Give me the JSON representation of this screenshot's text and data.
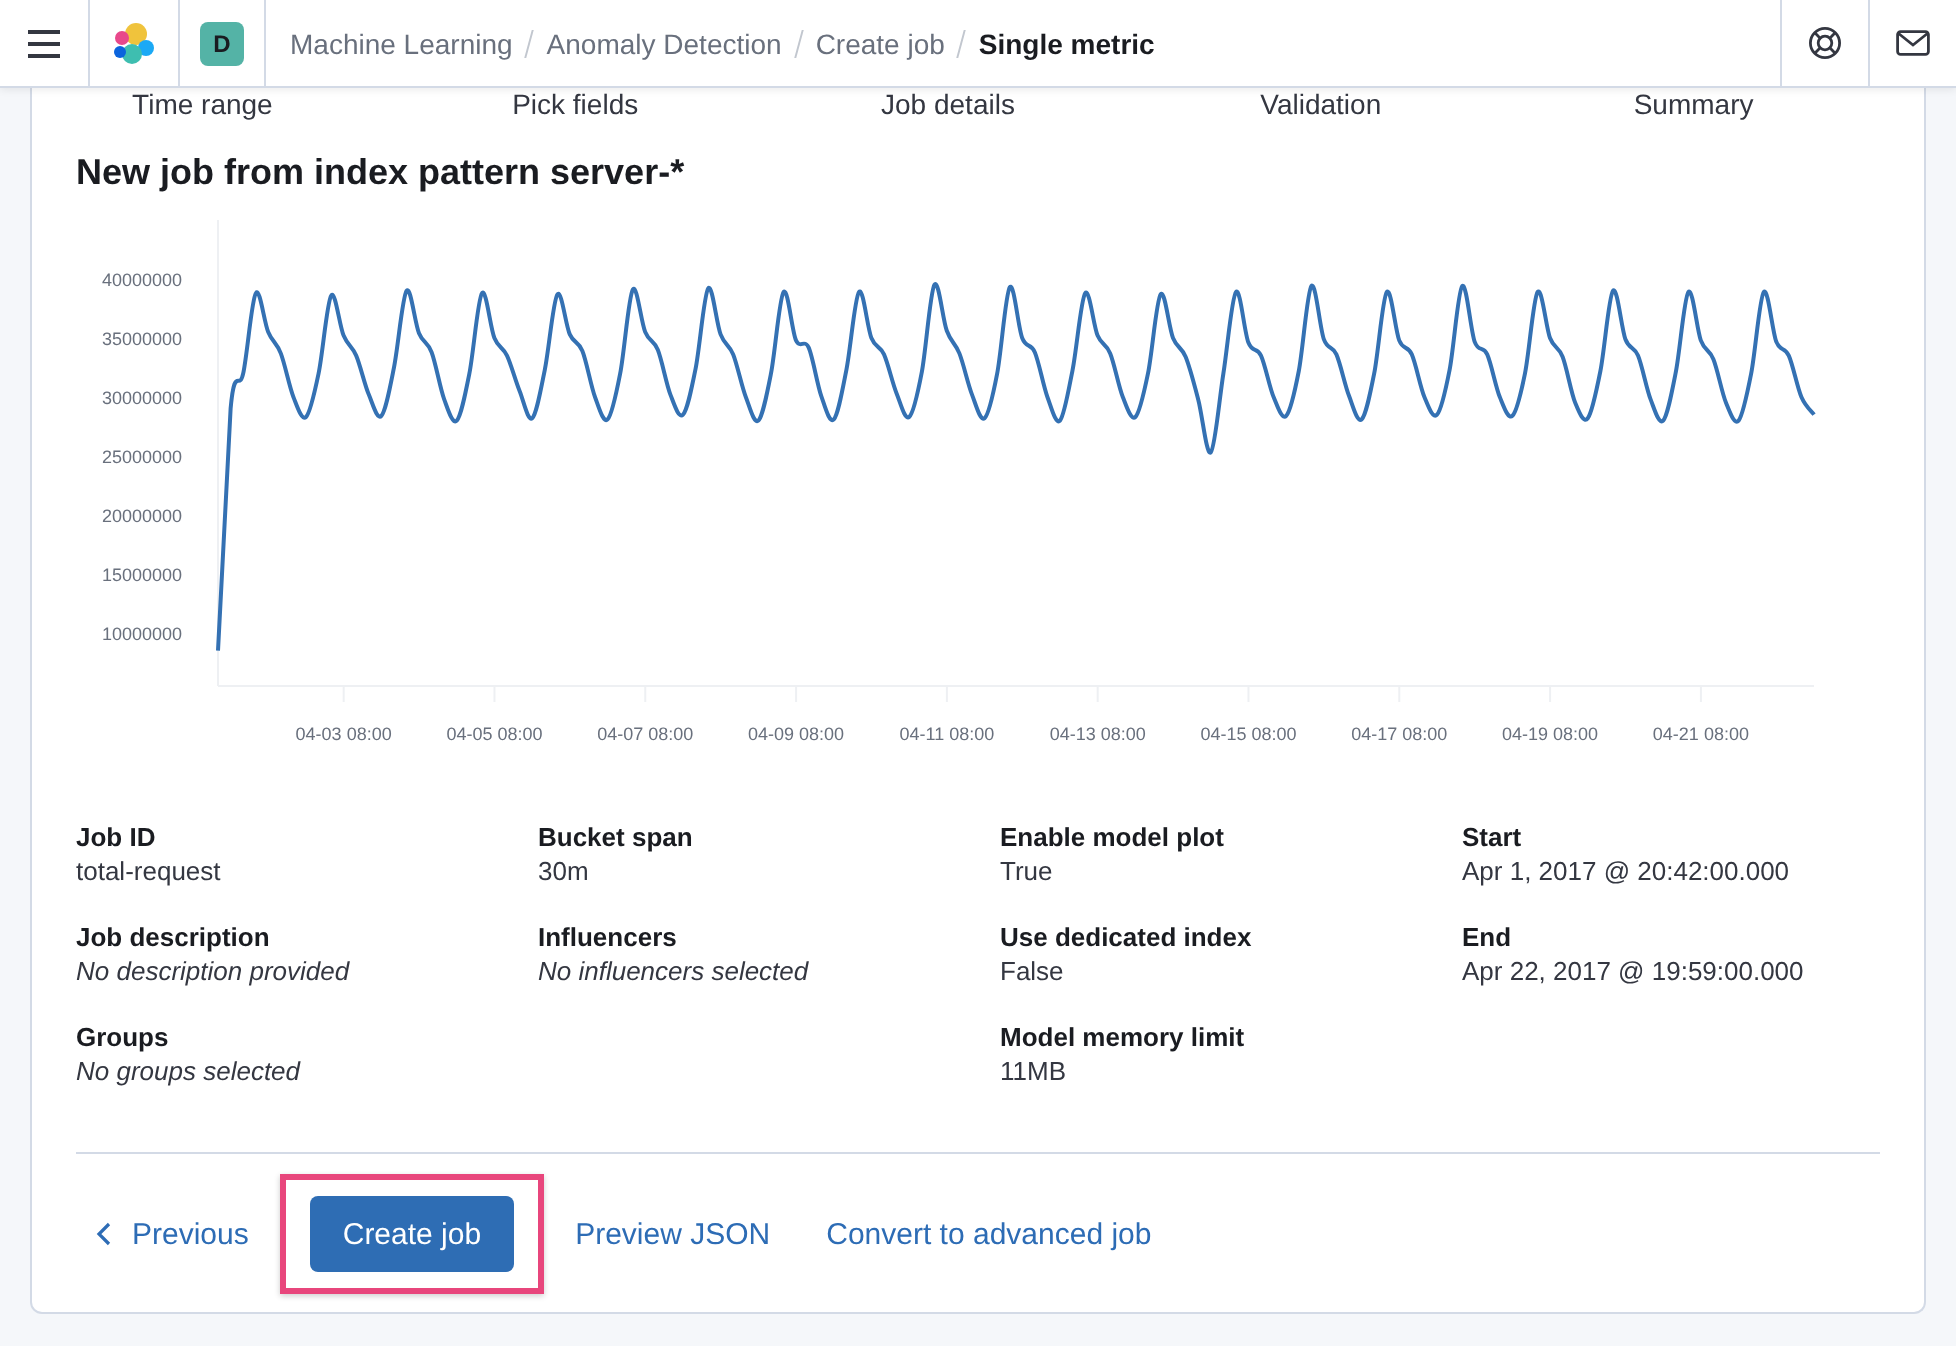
{
  "header": {
    "avatar": "D",
    "breadcrumbs": [
      {
        "label": "Machine Learning",
        "current": false
      },
      {
        "label": "Anomaly Detection",
        "current": false
      },
      {
        "label": "Create job",
        "current": false
      },
      {
        "label": "Single metric",
        "current": true
      }
    ]
  },
  "steps": [
    {
      "label": "Time range"
    },
    {
      "label": "Pick fields"
    },
    {
      "label": "Job details"
    },
    {
      "label": "Validation"
    },
    {
      "label": "Summary"
    }
  ],
  "panel": {
    "title": "New job from index pattern server-*",
    "chart_data": {
      "type": "line",
      "ylim": [
        5500000,
        45000000
      ],
      "categories": [
        null,
        null,
        null,
        null,
        null,
        null,
        null,
        null,
        null,
        null,
        "04-03 08:00",
        null,
        null,
        null,
        null,
        null,
        null,
        null,
        null,
        null,
        null,
        null,
        "04-05 08:00",
        null,
        null,
        null,
        null,
        null,
        null,
        null,
        null,
        null,
        null,
        null,
        "04-07 08:00",
        null,
        null,
        null,
        null,
        null,
        null,
        null,
        null,
        null,
        null,
        null,
        "04-09 08:00",
        null,
        null,
        null,
        null,
        null,
        null,
        null,
        null,
        null,
        null,
        null,
        "04-11 08:00",
        null,
        null,
        null,
        null,
        null,
        null,
        null,
        null,
        null,
        null,
        null,
        "04-13 08:00",
        null,
        null,
        null,
        null,
        null,
        null,
        null,
        null,
        null,
        null,
        null,
        "04-15 08:00",
        null,
        null,
        null,
        null,
        null,
        null,
        null,
        null,
        null,
        null,
        null,
        "04-17 08:00",
        null,
        null,
        null,
        null,
        null,
        null,
        null,
        null,
        null,
        null,
        null,
        "04-19 08:00",
        null,
        null,
        null,
        null,
        null,
        null,
        null,
        null,
        null,
        null,
        null,
        "04-21 08:00",
        null,
        null,
        null,
        null,
        null,
        null,
        null,
        null,
        null
      ],
      "yticks": [
        10000000,
        15000000,
        20000000,
        25000000,
        30000000,
        35000000,
        40000000
      ],
      "series": [
        {
          "color": "#3471b3",
          "values": [
            8500000,
            29000000,
            32000000,
            38800000,
            35500000,
            33700000,
            30000000,
            28300000,
            32000000,
            38600000,
            35200000,
            33500000,
            30200000,
            28400000,
            32500000,
            39000000,
            35400000,
            33800000,
            29800000,
            28000000,
            32000000,
            38800000,
            35000000,
            33500000,
            30500000,
            28200000,
            32300000,
            38700000,
            35300000,
            33900000,
            30000000,
            28100000,
            32000000,
            39100000,
            35500000,
            34000000,
            30200000,
            28500000,
            32400000,
            39200000,
            35300000,
            33600000,
            30000000,
            28000000,
            32000000,
            38900000,
            34800000,
            34200000,
            30100000,
            28100000,
            32300000,
            38900000,
            35000000,
            33600000,
            30300000,
            28300000,
            32100000,
            39500000,
            35600000,
            33700000,
            30200000,
            28200000,
            32000000,
            39300000,
            35000000,
            33800000,
            30000000,
            28000000,
            32300000,
            38800000,
            35200000,
            33700000,
            30000000,
            28300000,
            32000000,
            38700000,
            35000000,
            33400000,
            29800000,
            25300000,
            32000000,
            38900000,
            34600000,
            33500000,
            30000000,
            28400000,
            32200000,
            39400000,
            34900000,
            33600000,
            30100000,
            28100000,
            32000000,
            38900000,
            34800000,
            33600000,
            30000000,
            28500000,
            32300000,
            39400000,
            34700000,
            33600000,
            30000000,
            28400000,
            32000000,
            38900000,
            35000000,
            33400000,
            29500000,
            28200000,
            32200000,
            39000000,
            34900000,
            33500000,
            29800000,
            28000000,
            32100000,
            38900000,
            34800000,
            33200000,
            29500000,
            28000000,
            32000000,
            38900000,
            34700000,
            33500000,
            30000000,
            28500000
          ]
        }
      ]
    }
  },
  "details": [
    [
      {
        "label": "Job ID",
        "value": "total-request",
        "kind": "value"
      },
      {
        "label": "Job description",
        "value": "No description provided",
        "kind": "empty"
      },
      {
        "label": "Groups",
        "value": "No groups selected",
        "kind": "empty"
      }
    ],
    [
      {
        "label": "Bucket span",
        "value": "30m",
        "kind": "value"
      },
      {
        "label": "Influencers",
        "value": "No influencers selected",
        "kind": "empty"
      }
    ],
    [
      {
        "label": "Enable model plot",
        "value": "True",
        "kind": "value"
      },
      {
        "label": "Use dedicated index",
        "value": "False",
        "kind": "value"
      },
      {
        "label": "Model memory limit",
        "value": "11MB",
        "kind": "value"
      }
    ],
    [
      {
        "label": "Start",
        "value": "Apr 1, 2017 @ 20:42:00.000",
        "kind": "value"
      },
      {
        "label": "End",
        "value": "Apr 22, 2017 @ 19:59:00.000",
        "kind": "value"
      }
    ]
  ],
  "actions": [
    {
      "kind": "back",
      "label": "Previous",
      "highlighted": false
    },
    {
      "kind": "primary",
      "label": "Create job",
      "highlighted": true
    },
    {
      "kind": "link",
      "label": "Preview JSON",
      "highlighted": false
    },
    {
      "kind": "link",
      "label": "Convert to advanced job",
      "highlighted": false
    }
  ]
}
